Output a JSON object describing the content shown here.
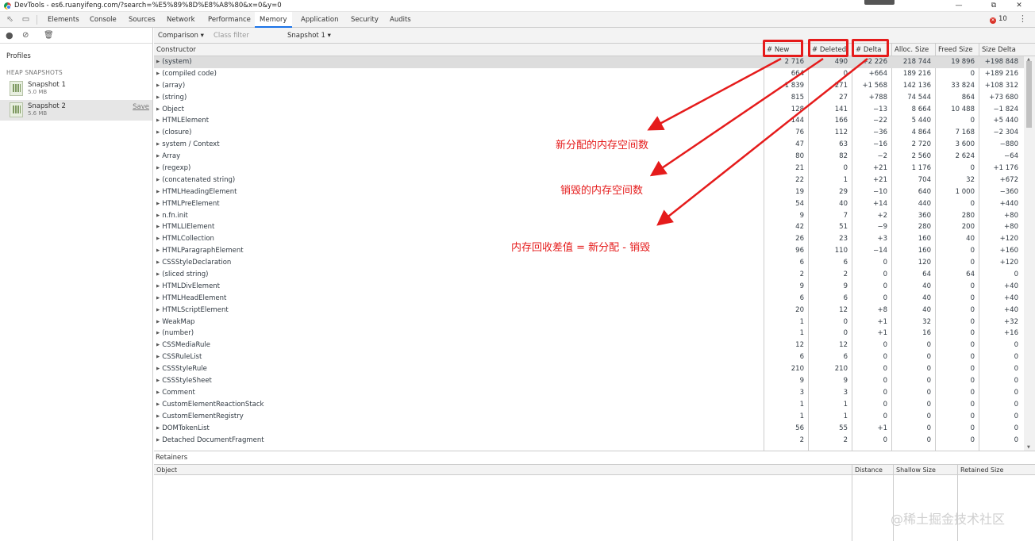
{
  "window": {
    "title": "DevTools - es6.ruanyifeng.com/?search=%E5%89%8D%E8%A8%80&x=0&y=0"
  },
  "colors": {
    "accent": "#1a73e8",
    "annotation": "#e51b1b",
    "selected_row": "#dddddd"
  },
  "tabs": [
    "Elements",
    "Console",
    "Sources",
    "Network",
    "Performance",
    "Memory",
    "Application",
    "Security",
    "Audits"
  ],
  "active_tab": "Memory",
  "error_count": "10",
  "sidebar": {
    "profiles_label": "Profiles",
    "heap_title": "HEAP SNAPSHOTS",
    "snapshots": [
      {
        "name": "Snapshot 1",
        "size": "5.0 MB"
      },
      {
        "name": "Snapshot 2",
        "size": "5.6 MB",
        "action": "Save"
      }
    ]
  },
  "toolbar": {
    "view": "Comparison",
    "filter_placeholder": "Class filter",
    "base": "Snapshot 1"
  },
  "columns": [
    "Constructor",
    "# New",
    "# Deleted",
    "# Delta",
    "Alloc. Size",
    "Freed Size",
    "Size Delta"
  ],
  "rows": [
    [
      "(system)",
      "2 716",
      "490",
      "+2 226",
      "218 744",
      "19 896",
      "+198 848"
    ],
    [
      "(compiled code)",
      "664",
      "0",
      "+664",
      "189 216",
      "0",
      "+189 216"
    ],
    [
      "(array)",
      "1 839",
      "271",
      "+1 568",
      "142 136",
      "33 824",
      "+108 312"
    ],
    [
      "(string)",
      "815",
      "27",
      "+788",
      "74 544",
      "864",
      "+73 680"
    ],
    [
      "Object",
      "128",
      "141",
      "−13",
      "8 664",
      "10 488",
      "−1 824"
    ],
    [
      "HTMLElement",
      "144",
      "166",
      "−22",
      "5 440",
      "0",
      "+5 440"
    ],
    [
      "(closure)",
      "76",
      "112",
      "−36",
      "4 864",
      "7 168",
      "−2 304"
    ],
    [
      "system / Context",
      "47",
      "63",
      "−16",
      "2 720",
      "3 600",
      "−880"
    ],
    [
      "Array",
      "80",
      "82",
      "−2",
      "2 560",
      "2 624",
      "−64"
    ],
    [
      "(regexp)",
      "21",
      "0",
      "+21",
      "1 176",
      "0",
      "+1 176"
    ],
    [
      "(concatenated string)",
      "22",
      "1",
      "+21",
      "704",
      "32",
      "+672"
    ],
    [
      "HTMLHeadingElement",
      "19",
      "29",
      "−10",
      "640",
      "1 000",
      "−360"
    ],
    [
      "HTMLPreElement",
      "54",
      "40",
      "+14",
      "440",
      "0",
      "+440"
    ],
    [
      "n.fn.init",
      "9",
      "7",
      "+2",
      "360",
      "280",
      "+80"
    ],
    [
      "HTMLLIElement",
      "42",
      "51",
      "−9",
      "280",
      "200",
      "+80"
    ],
    [
      "HTMLCollection",
      "26",
      "23",
      "+3",
      "160",
      "40",
      "+120"
    ],
    [
      "HTMLParagraphElement",
      "96",
      "110",
      "−14",
      "160",
      "0",
      "+160"
    ],
    [
      "CSSStyleDeclaration",
      "6",
      "6",
      "0",
      "120",
      "0",
      "+120"
    ],
    [
      "(sliced string)",
      "2",
      "2",
      "0",
      "64",
      "64",
      "0"
    ],
    [
      "HTMLDivElement",
      "9",
      "9",
      "0",
      "40",
      "0",
      "+40"
    ],
    [
      "HTMLHeadElement",
      "6",
      "6",
      "0",
      "40",
      "0",
      "+40"
    ],
    [
      "HTMLScriptElement",
      "20",
      "12",
      "+8",
      "40",
      "0",
      "+40"
    ],
    [
      "WeakMap",
      "1",
      "0",
      "+1",
      "32",
      "0",
      "+32"
    ],
    [
      "(number)",
      "1",
      "0",
      "+1",
      "16",
      "0",
      "+16"
    ],
    [
      "CSSMediaRule",
      "12",
      "12",
      "0",
      "0",
      "0",
      "0"
    ],
    [
      "CSSRuleList",
      "6",
      "6",
      "0",
      "0",
      "0",
      "0"
    ],
    [
      "CSSStyleRule",
      "210",
      "210",
      "0",
      "0",
      "0",
      "0"
    ],
    [
      "CSSStyleSheet",
      "9",
      "9",
      "0",
      "0",
      "0",
      "0"
    ],
    [
      "Comment",
      "3",
      "3",
      "0",
      "0",
      "0",
      "0"
    ],
    [
      "CustomElementReactionStack",
      "1",
      "1",
      "0",
      "0",
      "0",
      "0"
    ],
    [
      "CustomElementRegistry",
      "1",
      "1",
      "0",
      "0",
      "0",
      "0"
    ],
    [
      "DOMTokenList",
      "56",
      "55",
      "+1",
      "0",
      "0",
      "0"
    ],
    [
      "Detached DocumentFragment",
      "2",
      "2",
      "0",
      "0",
      "0",
      "0"
    ]
  ],
  "retainers": {
    "title": "Retainers",
    "columns": [
      "Object",
      "Distance",
      "Shallow Size",
      "Retained Size"
    ]
  },
  "annotations": [
    "新分配的内存空间数",
    "销毁的内存空间数",
    "内存回收差值 = 新分配 - 销毁"
  ],
  "watermark": "@稀土掘金技术社区"
}
